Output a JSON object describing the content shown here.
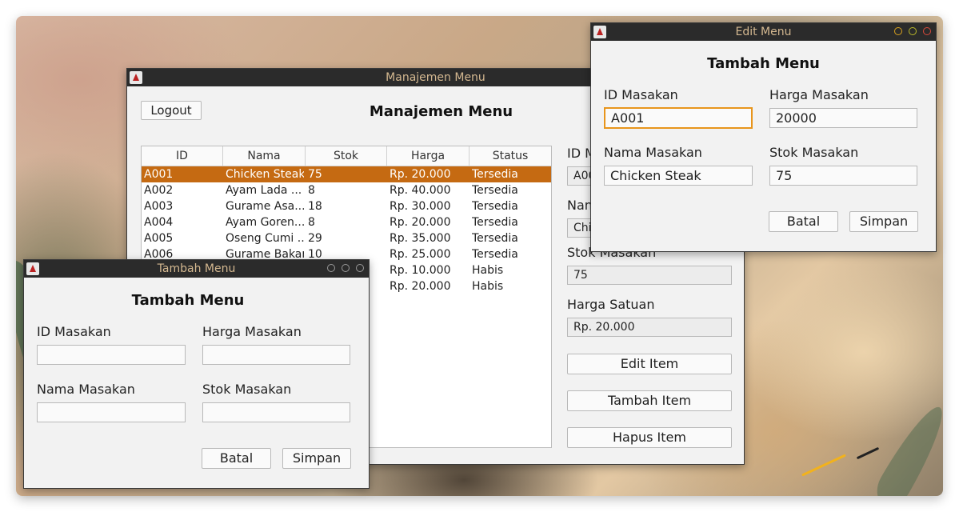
{
  "main_window": {
    "title": "Manajemen Menu",
    "logout_label": "Logout",
    "heading": "Manajemen Menu",
    "table": {
      "headers": [
        "ID",
        "Nama Masakan",
        "Stok",
        "Harga",
        "Status"
      ],
      "rows": [
        [
          "A001",
          "Chicken Steak",
          "75",
          "Rp. 20.000",
          "Tersedia"
        ],
        [
          "A002",
          "Ayam Lada ...",
          "8",
          "Rp. 40.000",
          "Tersedia"
        ],
        [
          "A003",
          "Gurame Asa...",
          "18",
          "Rp. 30.000",
          "Tersedia"
        ],
        [
          "A004",
          "Ayam Goren...",
          "8",
          "Rp. 20.000",
          "Tersedia"
        ],
        [
          "A005",
          "Oseng Cumi ...",
          "29",
          "Rp. 35.000",
          "Tersedia"
        ],
        [
          "A006",
          "Gurame Bakar",
          "10",
          "Rp. 25.000",
          "Tersedia"
        ],
        [
          "",
          "",
          "",
          "Rp. 10.000",
          "Habis"
        ],
        [
          "",
          "",
          "",
          "Rp. 20.000",
          "Habis"
        ]
      ],
      "selected_index": 0
    },
    "detail": {
      "id_label": "ID M",
      "id_value": "A00",
      "name_label": "Nam",
      "name_value": "Chi",
      "stock_label": "Stok Masakan",
      "stock_value": "75",
      "price_label": "Harga Satuan",
      "price_value": "Rp. 20.000"
    },
    "buttons": {
      "edit": "Edit Item",
      "add": "Tambah Item",
      "delete": "Hapus Item"
    }
  },
  "edit_window": {
    "title": "Edit Menu",
    "heading": "Tambah Menu",
    "id_label": "ID Masakan",
    "id_value": "A001",
    "price_label": "Harga Masakan",
    "price_value": "20000",
    "name_label": "Nama Masakan",
    "name_value": "Chicken Steak",
    "stock_label": "Stok Masakan",
    "stock_value": "75",
    "cancel_label": "Batal",
    "save_label": "Simpan",
    "control_color": "#d9a21e"
  },
  "add_window": {
    "title": "Tambah Menu",
    "heading": "Tambah Menu",
    "id_label": "ID Masakan",
    "id_value": "",
    "price_label": "Harga Masakan",
    "price_value": "",
    "name_label": "Nama Masakan",
    "name_value": "",
    "stock_label": "Stok Masakan",
    "stock_value": "",
    "cancel_label": "Batal",
    "save_label": "Simpan"
  },
  "colors": {
    "selection": "#c56a12",
    "titlebar": "#2b2b2b",
    "title_text": "#d4b890",
    "focus_border": "#e8951c"
  }
}
